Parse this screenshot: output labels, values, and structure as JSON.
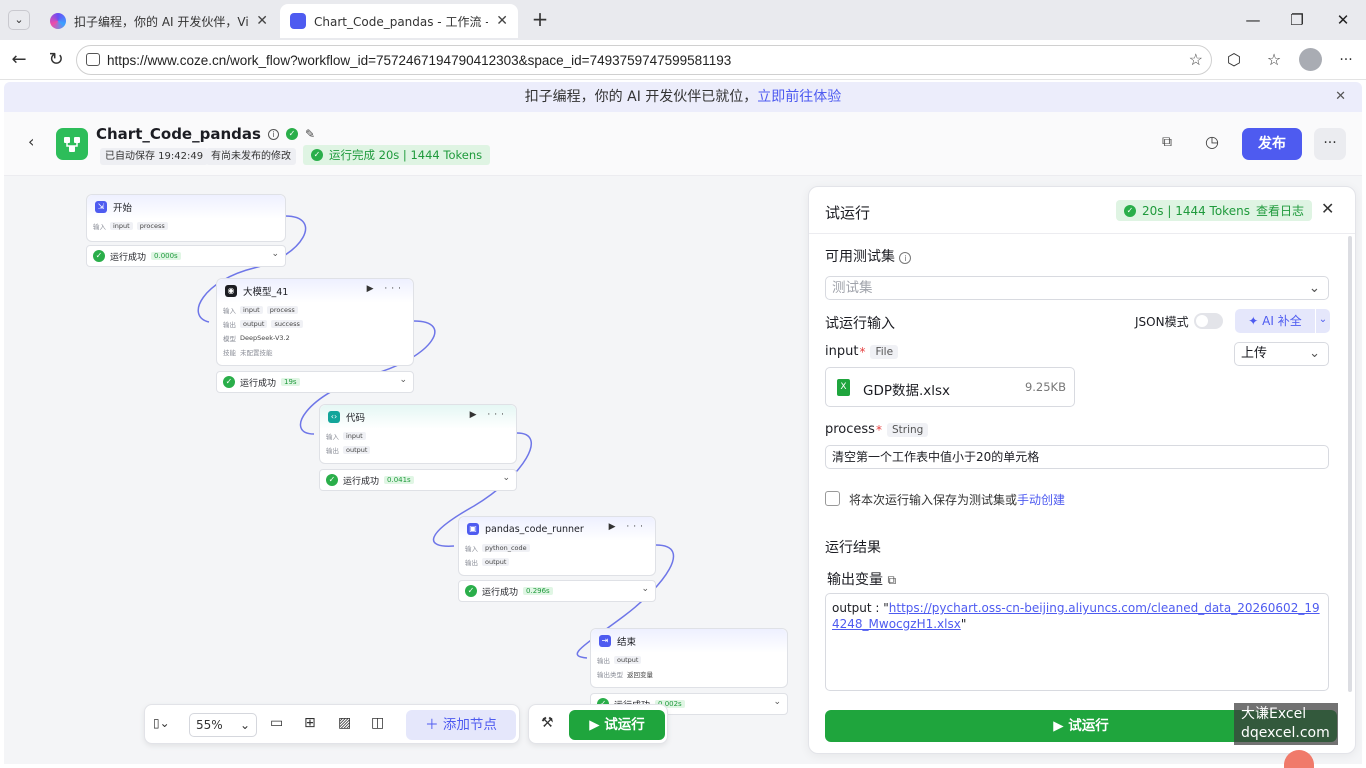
{
  "browser": {
    "tabs": [
      {
        "title": "扣子编程，你的 AI 开发伙伴，Vib"
      },
      {
        "title": "Chart_Code_pandas - 工作流 -智能"
      }
    ],
    "url": "https://www.coze.cn/work_flow?workflow_id=7572467194790412303&space_id=7493759747599581193"
  },
  "banner": {
    "text": "扣子编程，你的 AI 开发伙伴已就位，",
    "link": "立即前往体验"
  },
  "header": {
    "title": "Chart_Code_pandas",
    "autosave": "已自动保存 19:42:49",
    "unpublished": "有尚未发布的修改",
    "run_status": "运行完成 20s | 1444 Tokens",
    "publish_label": "发布",
    "colors": {
      "accent": "#4e5bf0",
      "success": "#2aae4a"
    }
  },
  "nodes": {
    "start": {
      "title": "开始",
      "input_label": "输入",
      "inputs": [
        "input",
        "process"
      ],
      "result": "运行成功",
      "time": "0.000s"
    },
    "llm": {
      "title": "大模型_41",
      "input_label": "输入",
      "inputs": [
        "input",
        "process"
      ],
      "output_label": "输出",
      "outputs": [
        "output",
        "success"
      ],
      "model_label": "模型",
      "model": "DeepSeek-V3.2",
      "skill_label": "技能",
      "skill": "未配置技能",
      "result": "运行成功",
      "time": "19s"
    },
    "code": {
      "title": "代码",
      "input_label": "输入",
      "input": "input",
      "output_label": "输出",
      "output": "output",
      "result": "运行成功",
      "time": "0.041s"
    },
    "runner": {
      "title": "pandas_code_runner",
      "input_label": "输入",
      "input": "python_code",
      "output_label": "输出",
      "output": "output",
      "result": "运行成功",
      "time": "0.296s"
    },
    "end": {
      "title": "结束",
      "output_label": "输出",
      "output": "output",
      "type_label": "输出类型",
      "type_value": "返回变量",
      "result": "运行成功",
      "time": "0.002s"
    }
  },
  "toolbar": {
    "zoom": "55%",
    "add_node": "添加节点",
    "run": "试运行"
  },
  "panel": {
    "title": "试运行",
    "stats": "20s | 1444 Tokens",
    "log_link": "查看日志",
    "testset_label": "可用测试集",
    "testset_placeholder": "测试集",
    "input_section": "试运行输入",
    "json_mode": "JSON模式",
    "ai_fill": "AI 补全",
    "input_name": "input",
    "input_type": "File",
    "upload": "上传",
    "file_name": "GDP数据.xlsx",
    "file_size": "9.25KB",
    "process_name": "process",
    "process_type": "String",
    "process_value": "清空第一个工作表中值小于20的单元格",
    "save_text": "将本次运行输入保存为测试集或",
    "save_link": "手动创建",
    "result_section": "运行结果",
    "output_vars": "输出变量",
    "output_key": "output : \"",
    "output_url": "https://pychart.oss-cn-beijing.aliyuncs.com/cleaned_data_20260602_194248_MwocgzH1.xlsx",
    "output_end": "\"",
    "run_button": "试运行"
  },
  "watermark": {
    "line1": "大谦Excel",
    "line2": "dqexcel.com"
  }
}
